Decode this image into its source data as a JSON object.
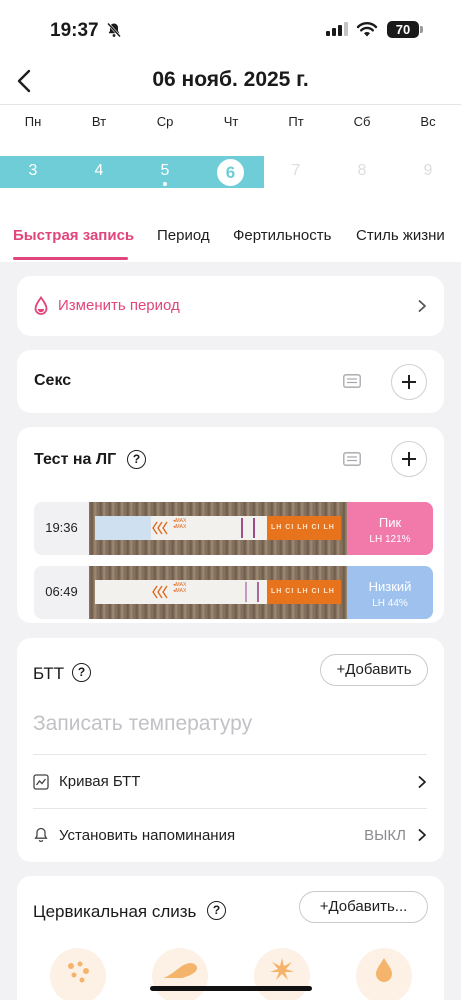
{
  "status_bar": {
    "time": "19:37",
    "battery": "70"
  },
  "header": {
    "title": "06 нояб. 2025 г."
  },
  "week": {
    "days": [
      "Пн",
      "Вт",
      "Ср",
      "Чт",
      "Пт",
      "Сб",
      "Вс"
    ],
    "dates": [
      "3",
      "4",
      "5",
      "6",
      "7",
      "8",
      "9"
    ]
  },
  "tabs": [
    "Быстрая запись",
    "Период",
    "Фертильность",
    "Стиль жизни"
  ],
  "period_card": {
    "label": "Изменить период"
  },
  "sex_card": {
    "title": "Секс"
  },
  "lh_card": {
    "title": "Тест на ЛГ",
    "help": "?",
    "entries": [
      {
        "time": "19:36",
        "level": "Пик",
        "percent": "LH 121%",
        "color": "#f27aaa"
      },
      {
        "time": "06:49",
        "level": "Низкий",
        "percent": "LH 44%",
        "color": "#9ec1ee"
      }
    ]
  },
  "bbt_card": {
    "title": "БТТ",
    "help": "?",
    "add_label": "Добавить",
    "placeholder": "Записать температуру",
    "curve_label": "Кривая БТТ",
    "reminder_label": "Установить напоминания",
    "reminder_value": "ВЫКЛ"
  },
  "mucus_card": {
    "title": "Цервикальная слизь",
    "help": "?",
    "add_label": "Добавить..."
  },
  "colors": {
    "accent_pink": "#e0457b",
    "teal": "#6fcdd8",
    "peak": "#f27aaa",
    "low": "#9ec1ee"
  }
}
